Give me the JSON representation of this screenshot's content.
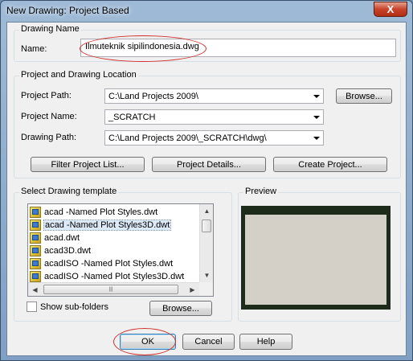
{
  "window": {
    "title": "New Drawing: Project Based",
    "close_label": "X"
  },
  "drawing_name": {
    "group_label": "Drawing Name",
    "name_label": "Name:",
    "name_value": "Ilmuteknik sipilindonesia.dwg"
  },
  "location": {
    "group_label": "Project and Drawing Location",
    "project_path_label": "Project Path:",
    "project_path_value": "C:\\Land Projects 2009\\",
    "browse_label": "Browse...",
    "project_name_label": "Project Name:",
    "project_name_value": "_SCRATCH",
    "drawing_path_label": "Drawing Path:",
    "drawing_path_value": "C:\\Land Projects 2009\\_SCRATCH\\dwg\\",
    "filter_label": "Filter Project List...",
    "details_label": "Project Details...",
    "create_label": "Create Project..."
  },
  "template": {
    "group_label": "Select Drawing template",
    "items": [
      {
        "label": "acad -Named Plot Styles.dwt"
      },
      {
        "label": "acad -Named Plot Styles3D.dwt"
      },
      {
        "label": "acad.dwt"
      },
      {
        "label": "acad3D.dwt"
      },
      {
        "label": "acadISO -Named Plot Styles.dwt"
      },
      {
        "label": "acadISO -Named Plot Styles3D.dwt"
      }
    ],
    "selected_index": 1,
    "show_subfolders_label": "Show sub-folders",
    "browse_label": "Browse..."
  },
  "preview": {
    "group_label": "Preview"
  },
  "footer": {
    "ok_label": "OK",
    "cancel_label": "Cancel",
    "help_label": "Help"
  },
  "colors": {
    "annotation": "#d0312d",
    "title_bar": "#8fadd0"
  }
}
